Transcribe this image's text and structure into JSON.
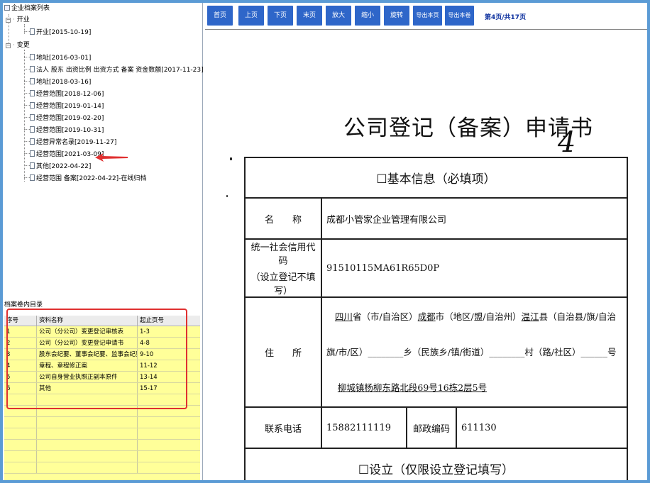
{
  "tree": {
    "root_label": "企业档案列表",
    "groups": [
      {
        "label": "开业",
        "items": [
          "开业[2015-10-19]"
        ]
      },
      {
        "label": "变更",
        "items": [
          "地址[2016-03-01]",
          "法人 股东 出资比例 出资方式 备案 资金数额[2017-11-23]",
          "地址[2018-03-16]",
          "经营范围[2018-12-06]",
          "经营范围[2019-01-14]",
          "经营范围[2019-02-20]",
          "经营范围[2019-10-31]",
          "经营异常名录[2019-11-27]",
          "经营范围[2021-03-09]",
          "其他[2022-04-22]",
          "经营范围 备案[2022-04-22]-在线归档"
        ]
      }
    ]
  },
  "catalog": {
    "title": "档案卷内目录",
    "headers": [
      "序号",
      "资料名称",
      "起止页号"
    ],
    "rows": [
      [
        "1",
        "公司（分公司）变更登记审核表",
        "1-3"
      ],
      [
        "2",
        "公司（分公司）变更登记申请书",
        "4-8"
      ],
      [
        "3",
        "股东会纪要、董事会纪要、监事会纪要",
        "9-10"
      ],
      [
        "4",
        "章程、章程修正案",
        "11-12"
      ],
      [
        "5",
        "公司自身营业执照正副本原件",
        "13-14"
      ],
      [
        "6",
        "其他",
        "15-17"
      ]
    ]
  },
  "toolbar": {
    "buttons": [
      "首页",
      "上页",
      "下页",
      "末页",
      "放大",
      "缩小",
      "旋转",
      "导出本页",
      "导出本卷"
    ],
    "page_indicator": "第4页/共17页",
    "button_color": "#2e66c9"
  },
  "document": {
    "title": "公司登记（备案）申请书",
    "handwritten_number": "4",
    "section1_heading": "☐基本信息（必填项）",
    "name_label": "名　　称",
    "name_value": "成都小管家企业管理有限公司",
    "credit_label_1": "统一社会信用代码",
    "credit_label_2": "（设立登记不填写）",
    "credit_value": "91510115MA61R65D0P",
    "address_label": "住　　所",
    "address_line1_prov": "四川",
    "address_line1_a": "省（市/自治区）",
    "address_line1_city": "成都",
    "address_line1_b": "市（地区/盟/自治州）",
    "address_line1_county": "温江",
    "address_line1_c": "县（自治县/旗/自治",
    "address_line2": "旗/市/区）________乡（民族乡/镇/街道）________村（路/社区）______号",
    "address_line3": "柳城镇杨柳东路北段69号16栋2层5号",
    "phone_label": "联系电话",
    "phone_value": "15882111119",
    "postcode_label": "邮政编码",
    "postcode_value": "611130",
    "section2_heading": "☐设立（仅限设立登记填写）"
  },
  "colors": {
    "frame_border": "#5b9bd5",
    "catalog_bg": "#ffff99",
    "annotation_red": "#e03030"
  }
}
